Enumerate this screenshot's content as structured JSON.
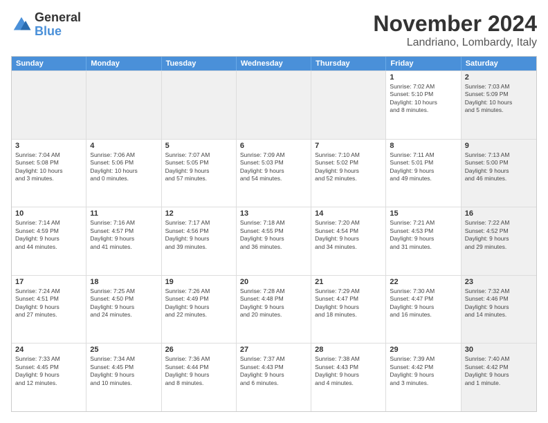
{
  "logo": {
    "line1": "General",
    "line2": "Blue"
  },
  "title": "November 2024",
  "subtitle": "Landriano, Lombardy, Italy",
  "header_days": [
    "Sunday",
    "Monday",
    "Tuesday",
    "Wednesday",
    "Thursday",
    "Friday",
    "Saturday"
  ],
  "rows": [
    [
      {
        "day": "",
        "info": "",
        "shaded": true
      },
      {
        "day": "",
        "info": "",
        "shaded": true
      },
      {
        "day": "",
        "info": "",
        "shaded": true
      },
      {
        "day": "",
        "info": "",
        "shaded": true
      },
      {
        "day": "",
        "info": "",
        "shaded": true
      },
      {
        "day": "1",
        "info": "Sunrise: 7:02 AM\nSunset: 5:10 PM\nDaylight: 10 hours\nand 8 minutes.",
        "shaded": false
      },
      {
        "day": "2",
        "info": "Sunrise: 7:03 AM\nSunset: 5:09 PM\nDaylight: 10 hours\nand 5 minutes.",
        "shaded": true
      }
    ],
    [
      {
        "day": "3",
        "info": "Sunrise: 7:04 AM\nSunset: 5:08 PM\nDaylight: 10 hours\nand 3 minutes.",
        "shaded": false
      },
      {
        "day": "4",
        "info": "Sunrise: 7:06 AM\nSunset: 5:06 PM\nDaylight: 10 hours\nand 0 minutes.",
        "shaded": false
      },
      {
        "day": "5",
        "info": "Sunrise: 7:07 AM\nSunset: 5:05 PM\nDaylight: 9 hours\nand 57 minutes.",
        "shaded": false
      },
      {
        "day": "6",
        "info": "Sunrise: 7:09 AM\nSunset: 5:03 PM\nDaylight: 9 hours\nand 54 minutes.",
        "shaded": false
      },
      {
        "day": "7",
        "info": "Sunrise: 7:10 AM\nSunset: 5:02 PM\nDaylight: 9 hours\nand 52 minutes.",
        "shaded": false
      },
      {
        "day": "8",
        "info": "Sunrise: 7:11 AM\nSunset: 5:01 PM\nDaylight: 9 hours\nand 49 minutes.",
        "shaded": false
      },
      {
        "day": "9",
        "info": "Sunrise: 7:13 AM\nSunset: 5:00 PM\nDaylight: 9 hours\nand 46 minutes.",
        "shaded": true
      }
    ],
    [
      {
        "day": "10",
        "info": "Sunrise: 7:14 AM\nSunset: 4:59 PM\nDaylight: 9 hours\nand 44 minutes.",
        "shaded": false
      },
      {
        "day": "11",
        "info": "Sunrise: 7:16 AM\nSunset: 4:57 PM\nDaylight: 9 hours\nand 41 minutes.",
        "shaded": false
      },
      {
        "day": "12",
        "info": "Sunrise: 7:17 AM\nSunset: 4:56 PM\nDaylight: 9 hours\nand 39 minutes.",
        "shaded": false
      },
      {
        "day": "13",
        "info": "Sunrise: 7:18 AM\nSunset: 4:55 PM\nDaylight: 9 hours\nand 36 minutes.",
        "shaded": false
      },
      {
        "day": "14",
        "info": "Sunrise: 7:20 AM\nSunset: 4:54 PM\nDaylight: 9 hours\nand 34 minutes.",
        "shaded": false
      },
      {
        "day": "15",
        "info": "Sunrise: 7:21 AM\nSunset: 4:53 PM\nDaylight: 9 hours\nand 31 minutes.",
        "shaded": false
      },
      {
        "day": "16",
        "info": "Sunrise: 7:22 AM\nSunset: 4:52 PM\nDaylight: 9 hours\nand 29 minutes.",
        "shaded": true
      }
    ],
    [
      {
        "day": "17",
        "info": "Sunrise: 7:24 AM\nSunset: 4:51 PM\nDaylight: 9 hours\nand 27 minutes.",
        "shaded": false
      },
      {
        "day": "18",
        "info": "Sunrise: 7:25 AM\nSunset: 4:50 PM\nDaylight: 9 hours\nand 24 minutes.",
        "shaded": false
      },
      {
        "day": "19",
        "info": "Sunrise: 7:26 AM\nSunset: 4:49 PM\nDaylight: 9 hours\nand 22 minutes.",
        "shaded": false
      },
      {
        "day": "20",
        "info": "Sunrise: 7:28 AM\nSunset: 4:48 PM\nDaylight: 9 hours\nand 20 minutes.",
        "shaded": false
      },
      {
        "day": "21",
        "info": "Sunrise: 7:29 AM\nSunset: 4:47 PM\nDaylight: 9 hours\nand 18 minutes.",
        "shaded": false
      },
      {
        "day": "22",
        "info": "Sunrise: 7:30 AM\nSunset: 4:47 PM\nDaylight: 9 hours\nand 16 minutes.",
        "shaded": false
      },
      {
        "day": "23",
        "info": "Sunrise: 7:32 AM\nSunset: 4:46 PM\nDaylight: 9 hours\nand 14 minutes.",
        "shaded": true
      }
    ],
    [
      {
        "day": "24",
        "info": "Sunrise: 7:33 AM\nSunset: 4:45 PM\nDaylight: 9 hours\nand 12 minutes.",
        "shaded": false
      },
      {
        "day": "25",
        "info": "Sunrise: 7:34 AM\nSunset: 4:45 PM\nDaylight: 9 hours\nand 10 minutes.",
        "shaded": false
      },
      {
        "day": "26",
        "info": "Sunrise: 7:36 AM\nSunset: 4:44 PM\nDaylight: 9 hours\nand 8 minutes.",
        "shaded": false
      },
      {
        "day": "27",
        "info": "Sunrise: 7:37 AM\nSunset: 4:43 PM\nDaylight: 9 hours\nand 6 minutes.",
        "shaded": false
      },
      {
        "day": "28",
        "info": "Sunrise: 7:38 AM\nSunset: 4:43 PM\nDaylight: 9 hours\nand 4 minutes.",
        "shaded": false
      },
      {
        "day": "29",
        "info": "Sunrise: 7:39 AM\nSunset: 4:42 PM\nDaylight: 9 hours\nand 3 minutes.",
        "shaded": false
      },
      {
        "day": "30",
        "info": "Sunrise: 7:40 AM\nSunset: 4:42 PM\nDaylight: 9 hours\nand 1 minute.",
        "shaded": true
      }
    ]
  ]
}
